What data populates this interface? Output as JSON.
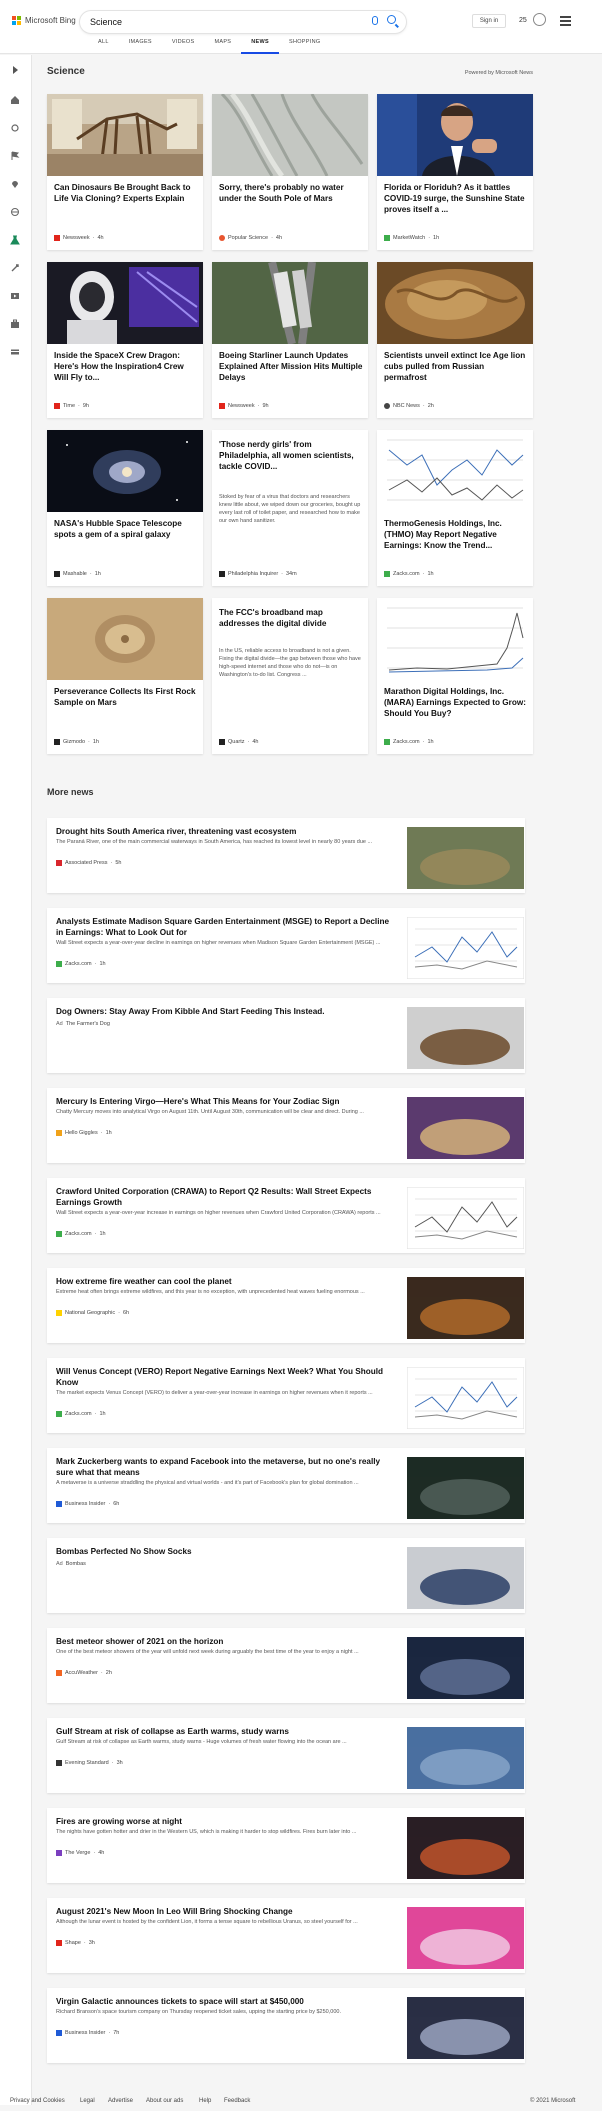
{
  "header": {
    "logo_text": "Microsoft Bing",
    "search_value": "Science",
    "signin_label": "Sign in",
    "points": "25",
    "tabs": [
      "ALL",
      "IMAGES",
      "VIDEOS",
      "MAPS",
      "NEWS",
      "SHOPPING"
    ],
    "active_tab": "NEWS"
  },
  "section": {
    "title": "Science",
    "powered": "Powered by Microsoft News"
  },
  "cards": [
    {
      "title": "Can Dinosaurs Be Brought Back to Life Via Cloning? Experts Explain",
      "source": "Newsweek",
      "age": "4h",
      "icon_color": "#e1251b"
    },
    {
      "title": "Sorry, there's probably no water under the South Pole of Mars",
      "source": "Popular Science",
      "age": "4h",
      "icon_color": "#e8552f"
    },
    {
      "title": "Florida or Floriduh? As it battles COVID-19 surge, the Sunshine State proves itself a ...",
      "source": "MarketWatch",
      "age": "1h",
      "icon_color": "#3dad4b"
    },
    {
      "title": "Inside the SpaceX Crew Dragon: Here's How the Inspiration4 Crew Will Fly to...",
      "source": "Time",
      "age": "9h",
      "icon_color": "#e1251b"
    },
    {
      "title": "Boeing Starliner Launch Updates Explained After Mission Hits Multiple Delays",
      "source": "Newsweek",
      "age": "9h",
      "icon_color": "#e1251b"
    },
    {
      "title": "Scientists unveil extinct Ice Age lion cubs pulled from Russian permafrost",
      "source": "NBC News",
      "age": "2h",
      "icon_color": "#444444"
    },
    {
      "title": "'Those nerdy girls' from Philadelphia, all women scientists, tackle COVID...",
      "desc": "Stoked by fear of a virus that doctors and researchers knew little about, we wiped down our groceries, bought up every last roll of toilet paper, and researched how to make our own hand sanitizer.",
      "source": "Philadelphia Inquirer",
      "age": "34m",
      "icon_color": "#222222"
    },
    {
      "title": "NASA's Hubble Space Telescope spots a gem of a spiral galaxy",
      "source": "Mashable",
      "age": "1h",
      "icon_color": "#222222"
    },
    {
      "title": "ThermoGenesis Holdings, Inc. (THMO) May Report Negative Earnings: Know the Trend...",
      "source": "Zacks.com",
      "age": "1h",
      "icon_color": "#3dad4b"
    },
    {
      "title": "Perseverance Collects Its First Rock Sample on Mars",
      "source": "Gizmodo",
      "age": "1h",
      "icon_color": "#222222"
    },
    {
      "title": "The FCC's broadband map addresses the digital divide",
      "desc": "In the US, reliable access to broadband is not a given. Fixing the digital divide—the gap between those who have high-speed internet and those who do not—is on Washington's to-do list. Congress ...",
      "source": "Quartz",
      "age": "4h",
      "icon_color": "#222222"
    },
    {
      "title": "Marathon Digital Holdings, Inc. (MARA) Earnings Expected to Grow: Should You Buy?",
      "source": "Zacks.com",
      "age": "1h",
      "icon_color": "#3dad4b"
    }
  ],
  "more_news_title": "More news",
  "news": [
    {
      "title": "Drought hits South America river, threatening vast ecosystem",
      "desc": "The Paraná River, one of the main commercial waterways in South America, has reached its lowest level in nearly 80 years due ...",
      "source": "Associated Press",
      "age": "5h",
      "icon_color": "#d9262c"
    },
    {
      "title": "Analysts Estimate Madison Square Garden Entertainment (MSGE) to Report a Decline in Earnings: What to Look Out for",
      "desc": "Wall Street expects a year-over-year decline in earnings on higher revenues when Madison Square Garden Entertainment (MSGE) ...",
      "source": "Zacks.com",
      "age": "1h",
      "icon_color": "#3dad4b"
    },
    {
      "title": "Dog Owners: Stay Away From Kibble And Start Feeding This Instead.",
      "desc": "",
      "source": "The Farmer's Dog",
      "age": "",
      "ad": "Ad",
      "icon_color": ""
    },
    {
      "title": "Mercury Is Entering Virgo—Here's What This Means for Your Zodiac Sign",
      "desc": "Chatty Mercury moves into analytical Virgo on August 11th. Until August 30th, communication will be clear and direct. During ...",
      "source": "Hello Giggles",
      "age": "1h",
      "icon_color": "#f0a21a"
    },
    {
      "title": "Crawford United Corporation (CRAWA) to Report Q2 Results: Wall Street Expects Earnings Growth",
      "desc": "Wall Street expects a year-over-year increase in earnings on higher revenues when Crawford United Corporation (CRAWA) reports ...",
      "source": "Zacks.com",
      "age": "1h",
      "icon_color": "#3dad4b"
    },
    {
      "title": "How extreme fire weather can cool the planet",
      "desc": "Extreme heat often brings extreme wildfires, and this year is no exception, with unprecedented heat waves fueling enormous ...",
      "source": "National Geographic",
      "age": "6h",
      "icon_color": "#ffd200"
    },
    {
      "title": "Will Venus Concept (VERO) Report Negative Earnings Next Week? What You Should Know",
      "desc": "The market expects Venus Concept (VERO) to deliver a year-over-year increase in earnings on higher revenues when it reports ...",
      "source": "Zacks.com",
      "age": "1h",
      "icon_color": "#3dad4b"
    },
    {
      "title": "Mark Zuckerberg wants to expand Facebook into the metaverse, but no one's really sure what that means",
      "desc": "A metaverse is a universe straddling the physical and virtual worlds - and it's part of Facebook's plan for global domination ...",
      "source": "Business Insider",
      "age": "6h",
      "icon_color": "#1f5ad6"
    },
    {
      "title": "Bombas Perfected No Show Socks",
      "desc": "",
      "source": "Bombas",
      "age": "",
      "ad": "Ad",
      "icon_color": ""
    },
    {
      "title": "Best meteor shower of 2021 on the horizon",
      "desc": "One of the best meteor showers of the year will unfold next week during arguably the best time of the year to enjoy a night ...",
      "source": "AccuWeather",
      "age": "2h",
      "icon_color": "#f26522"
    },
    {
      "title": "Gulf Stream at risk of collapse as Earth warms, study warns",
      "desc": "Gulf Stream at risk of collapse as Earth warms, study warns - Huge volumes of fresh water flowing into the ocean are ...",
      "source": "Evening Standard",
      "age": "3h",
      "icon_color": "#333333"
    },
    {
      "title": "Fires are growing worse at night",
      "desc": "The nights have gotten hotter and drier in the Western US, which is making it harder to stop wildfires. Fires burn later into ...",
      "source": "The Verge",
      "age": "4h",
      "icon_color": "#7b3fbf"
    },
    {
      "title": "August 2021's New Moon In Leo Will Bring Shocking Change",
      "desc": "Although the lunar event is hosted by the confident Lion, it forms a tense square to rebellious Uranus, so steel yourself for ...",
      "source": "Shape",
      "age": "3h",
      "icon_color": "#e1251b"
    },
    {
      "title": "Virgin Galactic announces tickets to space will start at $450,000",
      "desc": "Richard Branson's space tourism company on Thursday reopened ticket sales, upping the starting price by $250,000.",
      "source": "Business Insider",
      "age": "7h",
      "icon_color": "#1f5ad6"
    }
  ],
  "footer": {
    "links": [
      "Privacy and Cookies",
      "Legal",
      "Advertise",
      "About our ads",
      "Help",
      "Feedback"
    ],
    "copyright": "© 2021 Microsoft"
  }
}
